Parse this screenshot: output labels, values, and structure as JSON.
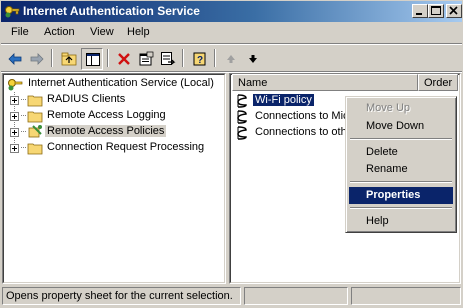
{
  "window": {
    "title": "Internet Authentication Service",
    "controls": [
      "minimize",
      "maximize",
      "close"
    ]
  },
  "menubar": {
    "items": [
      {
        "label": "File"
      },
      {
        "label": "Action"
      },
      {
        "label": "View"
      },
      {
        "label": "Help"
      }
    ]
  },
  "toolbar": {
    "buttons": [
      "back-arrow",
      "forward-arrow",
      "up-folder",
      "show-hide-console-tree",
      "delete-x",
      "properties-sheet",
      "export-list",
      "help-book",
      "move-up-arrow",
      "move-down-arrow"
    ]
  },
  "tree": {
    "root": "Internet Authentication Service (Local)",
    "items": [
      {
        "label": "RADIUS Clients"
      },
      {
        "label": "Remote Access Logging"
      },
      {
        "label": "Remote Access Policies"
      },
      {
        "label": "Connection Request Processing"
      }
    ]
  },
  "list": {
    "columns": [
      "Name",
      "Order"
    ],
    "rows": [
      {
        "name": "Wi-Fi policy"
      },
      {
        "name": "Connections to Micr"
      },
      {
        "name": "Connections to othe"
      }
    ]
  },
  "context_menu": {
    "items": [
      {
        "label": "Move Up",
        "disabled": true
      },
      {
        "label": "Move Down"
      },
      {
        "label": "Delete"
      },
      {
        "label": "Rename"
      },
      {
        "label": "Properties",
        "highlighted": true
      },
      {
        "label": "Help"
      }
    ]
  },
  "statusbar": {
    "text": "Opens property sheet for the current selection."
  },
  "colors": {
    "title_gradient_start": "#0a246a",
    "title_gradient_end": "#a6caf0",
    "selection": "#0a246a",
    "face": "#d4d0c8"
  }
}
